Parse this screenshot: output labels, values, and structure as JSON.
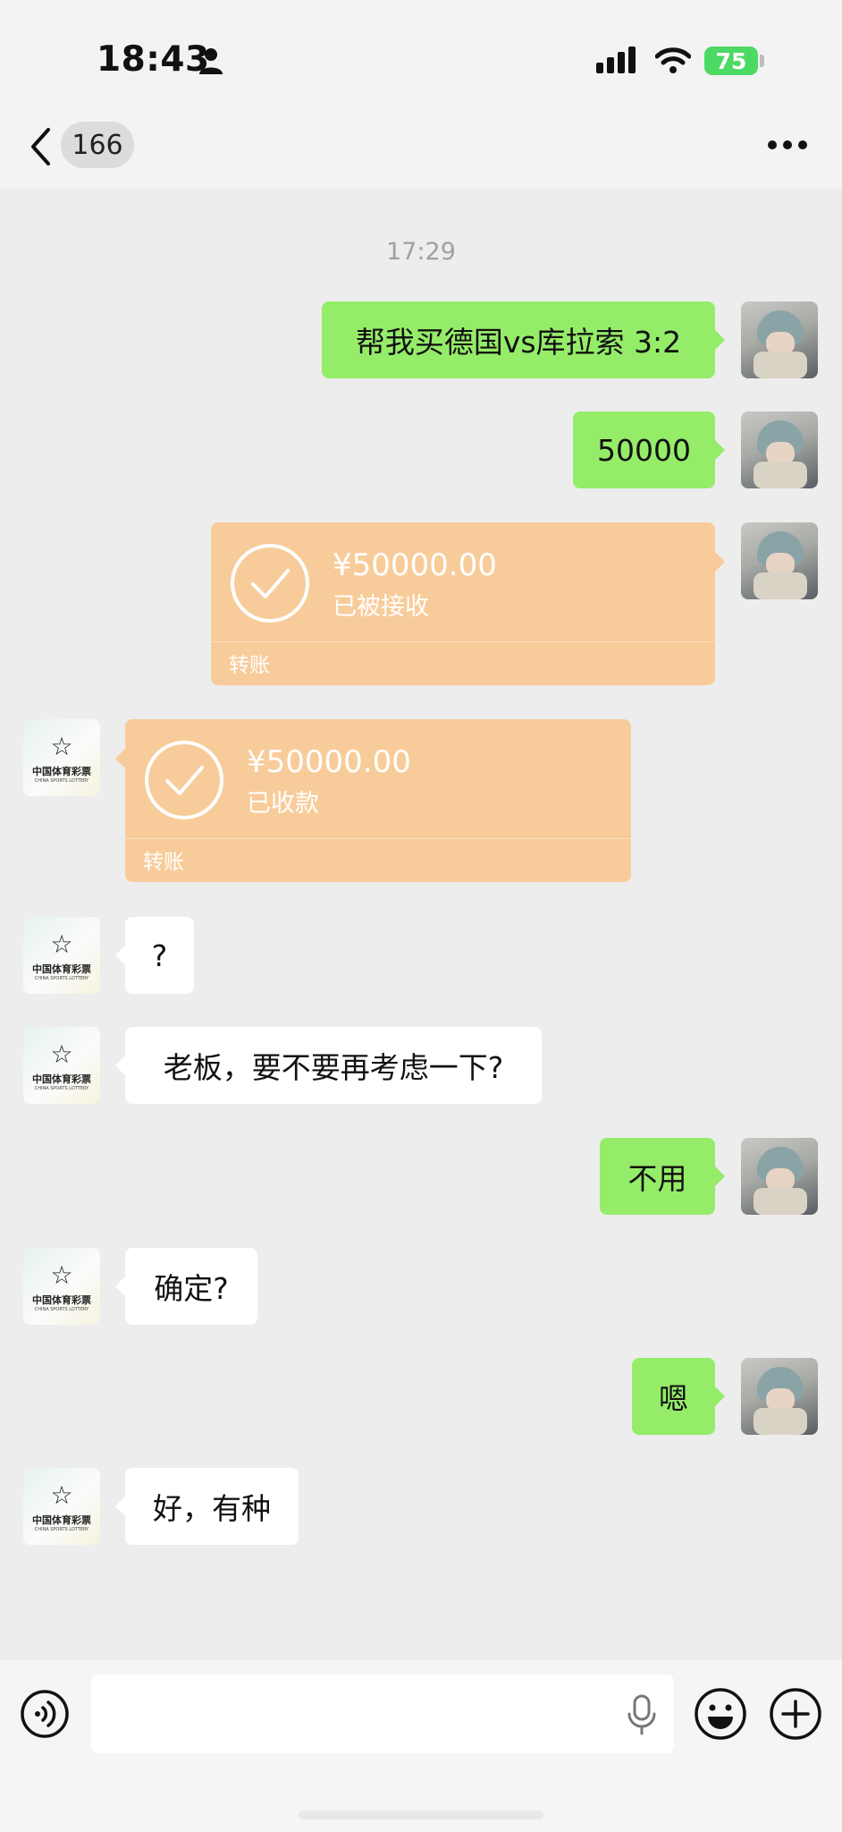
{
  "status_bar": {
    "time": "18:43",
    "battery": "75"
  },
  "nav": {
    "unread_count": "166"
  },
  "chat": {
    "timestamp": "17:29",
    "lottery_logo": {
      "cn": "中国体育彩票",
      "en": "CHINA SPORTS LOTTERY"
    },
    "messages": [
      {
        "sender": "me",
        "type": "text",
        "text": "帮我买德国vs库拉索 3:2"
      },
      {
        "sender": "me",
        "type": "text",
        "text": "50000"
      },
      {
        "sender": "me",
        "type": "transfer",
        "amount": "¥50000.00",
        "status": "已被接收",
        "footer": "转账"
      },
      {
        "sender": "other",
        "type": "transfer",
        "amount": "¥50000.00",
        "status": "已收款",
        "footer": "转账"
      },
      {
        "sender": "other",
        "type": "text",
        "text": "?"
      },
      {
        "sender": "other",
        "type": "text",
        "text": "老板，要不要再考虑一下?"
      },
      {
        "sender": "me",
        "type": "text",
        "text": "不用"
      },
      {
        "sender": "other",
        "type": "text",
        "text": "确定?"
      },
      {
        "sender": "me",
        "type": "text",
        "text": "嗯"
      },
      {
        "sender": "other",
        "type": "text",
        "text": "好，有种"
      }
    ]
  },
  "input_bar": {
    "value": "",
    "placeholder": ""
  },
  "icons": [
    "person-icon",
    "signal-icon",
    "wifi-icon",
    "back-icon",
    "more-icon",
    "check-circle-icon",
    "voice-icon",
    "mic-icon",
    "emoji-icon",
    "plus-icon"
  ],
  "colors": {
    "self_bubble": "#95ec69",
    "other_bubble": "#ffffff",
    "transfer_card": "#f8cc9a",
    "battery": "#4cd964",
    "background": "#ededed"
  }
}
